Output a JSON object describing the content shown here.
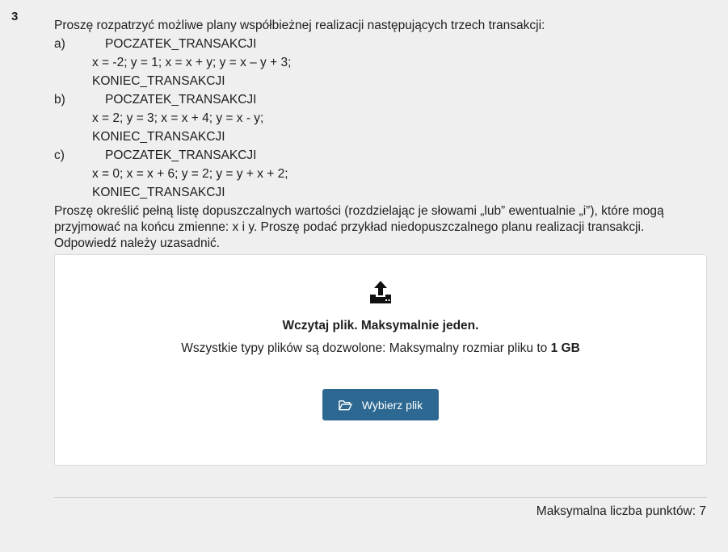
{
  "question": {
    "number": "3",
    "intro": "Proszę rozpatrzyć możliwe plany współbieżnej realizacji następujących trzech transakcji:",
    "transactions": [
      {
        "label": "a)",
        "begin": "POCZATEK_TRANSAKCJI",
        "ops": "x = -2; y = 1; x = x + y; y = x – y + 3;",
        "end": "KONIEC_TRANSAKCJI"
      },
      {
        "label": "b)",
        "begin": "POCZATEK_TRANSAKCJI",
        "ops": "x = 2; y = 3; x = x + 4; y = x - y;",
        "end": "KONIEC_TRANSAKCJI"
      },
      {
        "label": "c)",
        "begin": "POCZATEK_TRANSAKCJI",
        "ops": "x = 0; x = x + 6; y = 2; y = y + x + 2;",
        "end": "KONIEC_TRANSAKCJI"
      }
    ],
    "closing": "Proszę określić pełną listę dopuszczalnych wartości (rozdzielając je słowami „lub” ewentualnie „i”), które mogą przyjmować na końcu zmienne: x i y. Proszę podać przykład niedopuszczalnego planu realizacji transakcji. Odpowiedź należy uzasadnić."
  },
  "upload": {
    "icon": "upload-icon",
    "title": "Wczytaj plik. Maksymalnie jeden.",
    "info_prefix": "Wszystkie typy plików są dozwolone: Maksymalny rozmiar pliku to ",
    "info_size": "1 GB",
    "button_label": "Wybierz plik",
    "button_icon": "folder-open-icon",
    "button_color": "#2d6892"
  },
  "footer": {
    "max_points": "Maksymalna liczba punktów: 7"
  }
}
